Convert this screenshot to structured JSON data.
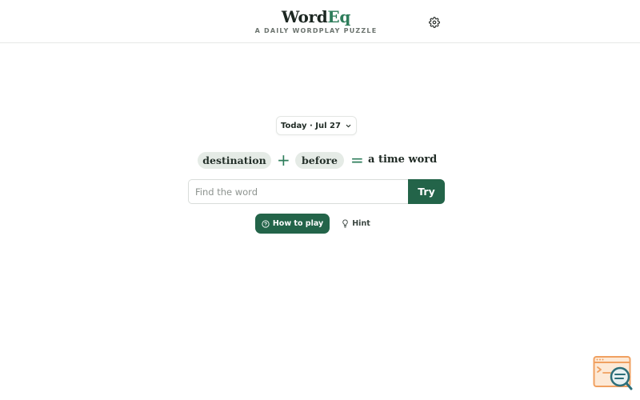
{
  "header": {
    "logo_main": "Word",
    "logo_accent": "Eq",
    "tagline": "A DAILY WORDPLAY PUZZLE",
    "settings_icon": "gear-icon"
  },
  "date_selector": {
    "label": "Today · Jul 27",
    "icon": "chevron-down-icon"
  },
  "puzzle": {
    "term1": "destination",
    "operator1": "+",
    "term2": "before",
    "operator2": "=",
    "result": "a time word"
  },
  "answer": {
    "placeholder": "Find the word",
    "value": "",
    "submit_label": "Try"
  },
  "actions": {
    "how_to_play_label": "How to play",
    "how_to_play_icon": "help-circle-icon",
    "hint_label": "Hint",
    "hint_icon": "lightbulb-icon"
  },
  "floating_widget": {
    "icon": "browser-search-icon"
  },
  "colors": {
    "accent": "#2e7d5b",
    "primary_button": "#236449",
    "chip_bg": "#e5ebe6",
    "widget_orange": "#f0a060",
    "widget_teal": "#2c6f7a"
  }
}
